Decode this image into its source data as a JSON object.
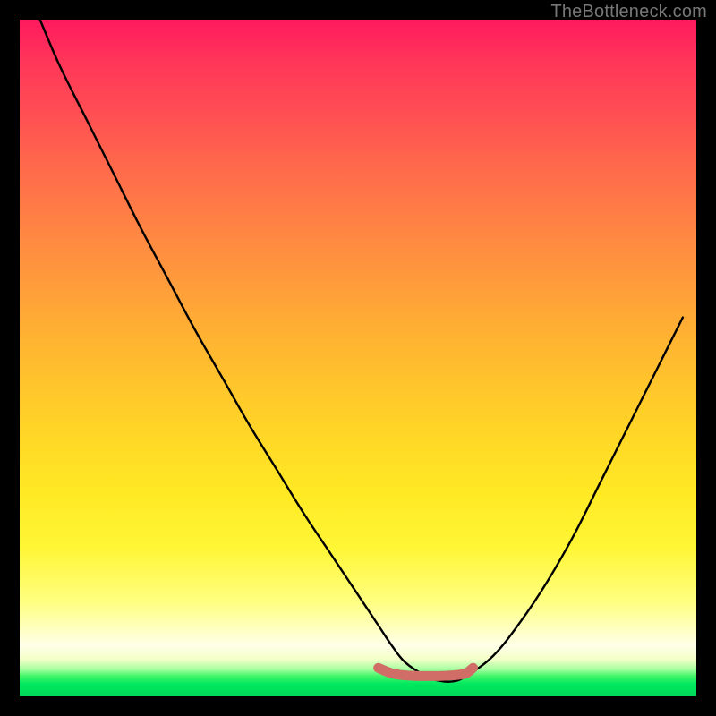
{
  "watermark": "TheBottleneck.com",
  "colors": {
    "frame": "#000000",
    "curve": "#000000",
    "sweet_spot": "#cf6d66",
    "gradient_top": "#ff1a5e",
    "gradient_bottom": "#00d858"
  },
  "chart_data": {
    "type": "line",
    "title": "",
    "xlabel": "",
    "ylabel": "",
    "xlim": [
      0,
      100
    ],
    "ylim": [
      0,
      100
    ],
    "grid": false,
    "series": [
      {
        "name": "bottleneck-curve",
        "x": [
          3,
          6,
          10,
          14,
          18,
          22,
          26,
          30,
          34,
          38,
          42,
          46,
          50,
          53,
          55,
          57,
          60,
          62,
          64,
          66,
          70,
          74,
          78,
          82,
          86,
          90,
          94,
          98
        ],
        "y": [
          100,
          93,
          85,
          77,
          69,
          61.5,
          54,
          47,
          40,
          33.5,
          27,
          21,
          15,
          10.5,
          7.5,
          5,
          3,
          2.3,
          2.2,
          3,
          6,
          11,
          17,
          24,
          32,
          40,
          48,
          56
        ]
      },
      {
        "name": "sweet-spot-highlight",
        "x": [
          53,
          55,
          57,
          59,
          60,
          62,
          64,
          65,
          66,
          67
        ],
        "y": [
          4.2,
          3.4,
          3.1,
          3.0,
          3.0,
          3.0,
          3.1,
          3.2,
          3.4,
          4.2
        ]
      }
    ]
  }
}
